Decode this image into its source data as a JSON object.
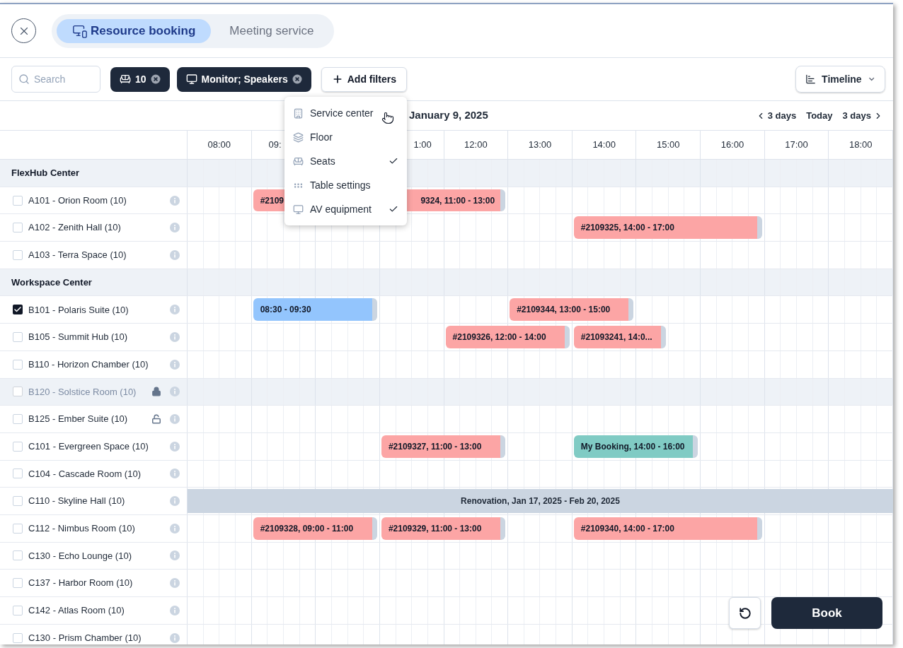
{
  "tabs": [
    {
      "label": "Resource booking",
      "selected": true
    },
    {
      "label": "Meeting service",
      "selected": false
    }
  ],
  "search": {
    "placeholder": "Search"
  },
  "filter_chips": [
    {
      "kind": "seats",
      "label": "10"
    },
    {
      "kind": "av",
      "label": "Monitor; Speakers"
    }
  ],
  "add_filters_button": "Add filters",
  "view_select": {
    "value": "Timeline"
  },
  "filter_menu": [
    {
      "kind": "building",
      "label": "Service center",
      "checked": false
    },
    {
      "kind": "layers",
      "label": "Floor",
      "checked": false
    },
    {
      "kind": "seats",
      "label": "Seats",
      "checked": true
    },
    {
      "kind": "table",
      "label": "Table settings",
      "checked": false
    },
    {
      "kind": "av",
      "label": "AV equipment",
      "checked": true
    }
  ],
  "date": "January 9, 2025",
  "navigation": {
    "previous": "3 days",
    "today": "Today",
    "next": "3 days"
  },
  "time_columns": [
    {
      "label": "08:00"
    },
    {
      "label": "09:",
      "cut_end": true
    },
    {},
    {
      "label": "1:00",
      "cut_start": true
    },
    {
      "label": "12:00"
    },
    {
      "label": "13:00"
    },
    {
      "label": "14:00"
    },
    {
      "label": "15:00"
    },
    {
      "label": "16:00"
    },
    {
      "label": "17:00"
    },
    {
      "label": "18:00"
    }
  ],
  "groups": [
    {
      "name": "FlexHub Center",
      "resources": [
        {
          "name": "A101 - Orion Room (10)",
          "checked": false,
          "disabled": false,
          "bookings": [
            {
              "kind": "booked",
              "label": "#2109"
            },
            {
              "kind": "booked",
              "label": "9324, 11:00 - 13:00",
              "cut_start": true
            }
          ]
        },
        {
          "name": "A102 - Zenith Hall (10)",
          "checked": false,
          "disabled": false,
          "bookings": [
            {
              "kind": "booked",
              "label": "#2109325, 14:00 - 17:00"
            }
          ]
        },
        {
          "name": "A103 - Terra Space (10)",
          "checked": false,
          "disabled": false
        }
      ]
    },
    {
      "name": "Workspace Center",
      "resources": [
        {
          "name": "B101 - Polaris Suite (10)",
          "checked": true,
          "disabled": false,
          "bookings": [
            {
              "kind": "selection",
              "label": "08:30  - 09:30"
            },
            {
              "kind": "booked",
              "label": "#2109344, 13:00 - 15:00"
            }
          ]
        },
        {
          "name": "B105 - Summit Hub (10)",
          "checked": false,
          "disabled": false,
          "bookings": [
            {
              "kind": "booked",
              "label": "#2109326, 12:00 - 14:00"
            },
            {
              "kind": "booked",
              "label": "#21093241, 14:0..."
            }
          ]
        },
        {
          "name": "B110 - Horizon Chamber (10)",
          "checked": false,
          "disabled": false
        },
        {
          "name": "B120 - Solstice Room  (10)",
          "checked": false,
          "disabled": true,
          "locked": true
        },
        {
          "name": "B125 - Ember Suite (10)",
          "checked": false,
          "disabled": false,
          "locked": false
        },
        {
          "name": "C101 - Evergreen Space (10)",
          "checked": false,
          "disabled": false,
          "bookings": [
            {
              "kind": "booked",
              "label": "#2109327, 11:00 - 13:00"
            },
            {
              "kind": "mine",
              "label": "My Booking, 14:00 - 16:00"
            }
          ]
        },
        {
          "name": "C104 - Cascade Room (10)",
          "checked": false,
          "disabled": false
        },
        {
          "name": "C110 - Skyline Hall (10)",
          "checked": false,
          "disabled": false,
          "closure": "Renovation, Jan 17, 2025 - Feb 20, 2025"
        },
        {
          "name": "C112 - Nimbus Room (10)",
          "checked": false,
          "disabled": false,
          "bookings": [
            {
              "kind": "booked",
              "label": "#2109328, 09:00 - 11:00"
            },
            {
              "kind": "booked",
              "label": "#2109329, 11:00 - 13:00"
            },
            {
              "kind": "booked",
              "label": "#2109340, 14:00 - 17:00"
            }
          ]
        },
        {
          "name": "C130 - Echo Lounge (10)",
          "checked": false,
          "disabled": false
        },
        {
          "name": "C137 - Harbor Room (10)",
          "checked": false,
          "disabled": false
        },
        {
          "name": "C142 - Atlas Room (10)",
          "checked": false,
          "disabled": false
        },
        {
          "name": "C130 - Prism Chamber (10)",
          "checked": false,
          "disabled": false
        }
      ]
    }
  ],
  "book_button": "Book"
}
